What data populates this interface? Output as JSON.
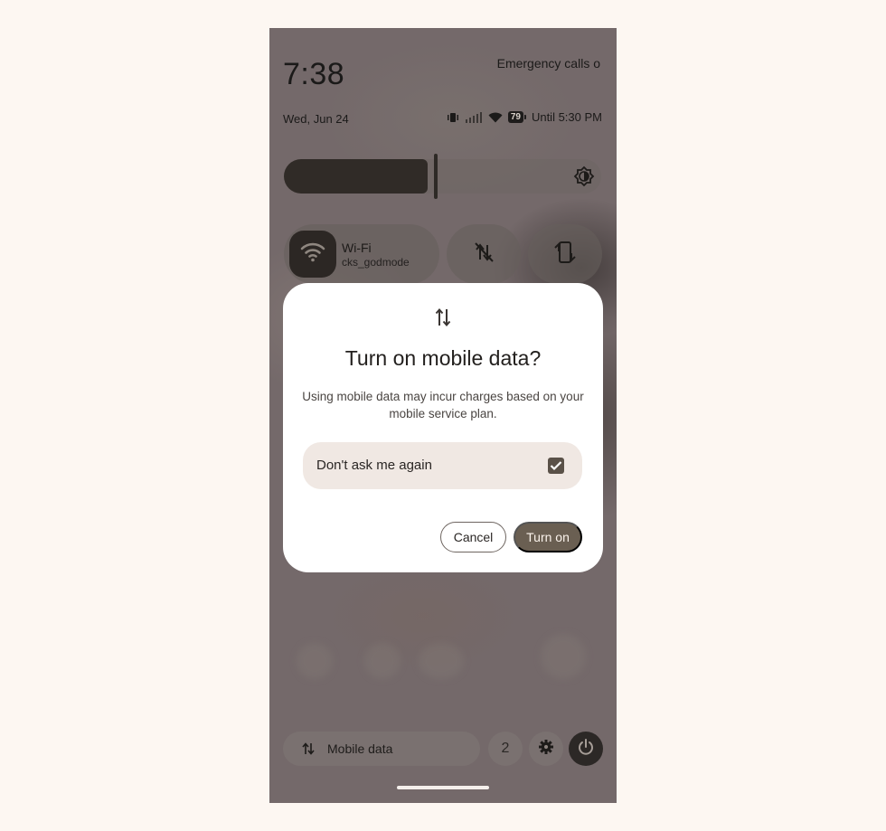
{
  "status": {
    "time": "7:38",
    "emergency": "Emergency calls o",
    "date": "Wed, Jun 24",
    "battery": "79",
    "until": "Until 5:30 PM"
  },
  "tiles": {
    "wifi_title": "Wi-Fi",
    "wifi_network": "cks_godmode"
  },
  "dialog": {
    "title": "Turn on mobile data?",
    "body": "Using mobile data may incur charges based on your mobile service plan.",
    "checkbox_label": "Don't ask me again",
    "checkbox_checked": true,
    "cancel_label": "Cancel",
    "confirm_label": "Turn on"
  },
  "footer": {
    "mobile_data_label": "Mobile data",
    "users_count": "2"
  },
  "colors": {
    "dialog_bg": "#ffffff",
    "primary_button": "#6a5f52",
    "checkbox": "#5a5148",
    "scrim": "#74696a"
  }
}
